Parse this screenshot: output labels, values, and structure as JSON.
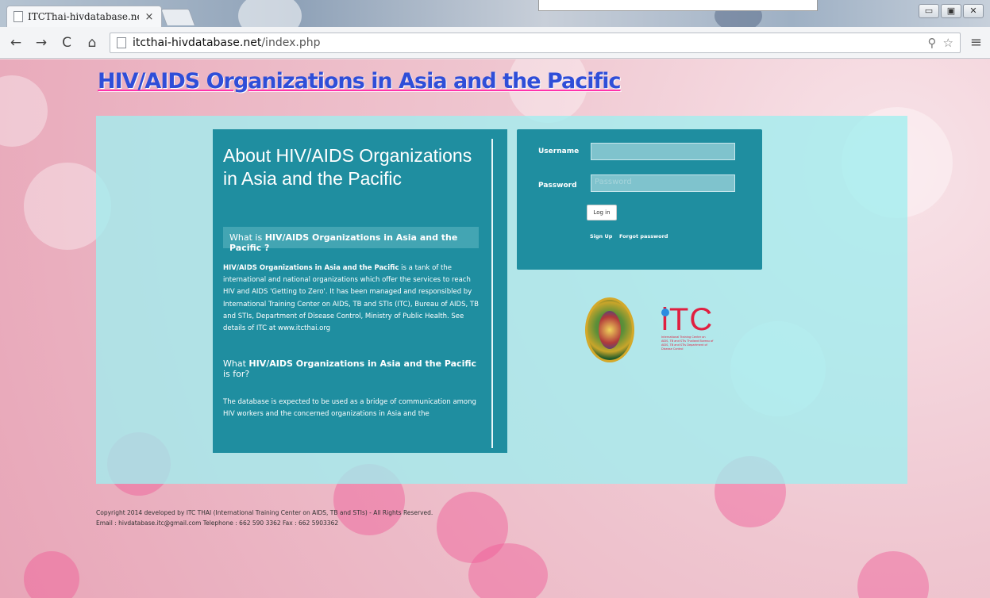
{
  "browser": {
    "tab_title": "ITCThai-hivdatabase.net",
    "tab_close": "×",
    "url_host": "itcthai-hivdatabase.net",
    "url_path": "/index.php",
    "window_buttons": [
      "▭",
      "▣",
      "✕"
    ]
  },
  "site": {
    "title": "HIV/AIDS Organizations in Asia and the Pacific"
  },
  "about": {
    "title": "About HIV/AIDS Organizations in Asia and the Pacific",
    "section1_prefix": "What is ",
    "section1_bold": "HIV/AIDS Organizations in Asia and the Pacific ?",
    "paragraph1_bold": "HIV/AIDS Organizations in Asia and the Pacific",
    "paragraph1_rest": " is a tank of the international and national organizations which offer the services to reach HIV and AIDS 'Getting to Zero'. It has been managed and responsibled by International Training Center on AIDS, TB and STIs (ITC), Bureau of AIDS, TB and STIs, Department of Disease Control, Ministry of Public Health. See details of ITC at www.itcthai.org",
    "section2_prefix": "What ",
    "section2_bold": "HIV/AIDS Organizations in Asia and the Pacific",
    "section2_suffix": " is for?",
    "paragraph2": "The database is expected to be used as a bridge of communication among HIV workers and the concerned organizations in Asia and the"
  },
  "login": {
    "username_label": "Username",
    "username_value": "",
    "password_label": "Password",
    "password_placeholder": "Password",
    "login_button": "Log in",
    "signup_link": "Sign Up",
    "forgot_link": "Forgot password"
  },
  "logos": {
    "itc_text": "iTC",
    "itc_subtitle": "International Training Center on AIDS, TB and STIs Thailand Bureau of AIDS, TB and STIs Department of Disease Control"
  },
  "footer": {
    "line1": "Copyright 2014 developed by ITC THAI (International Training Center on AIDS, TB and STIs) - All Rights Reserved.",
    "line2": "Email : hivdatabase.itc@gmail.com     Telephone : 662 590 3362 Fax : 662 5903362"
  },
  "colors": {
    "panel_teal": "#1f8ea0",
    "title_blue": "#2f4ed8",
    "title_underline": "#ff33aa",
    "itc_red": "#e02040"
  }
}
